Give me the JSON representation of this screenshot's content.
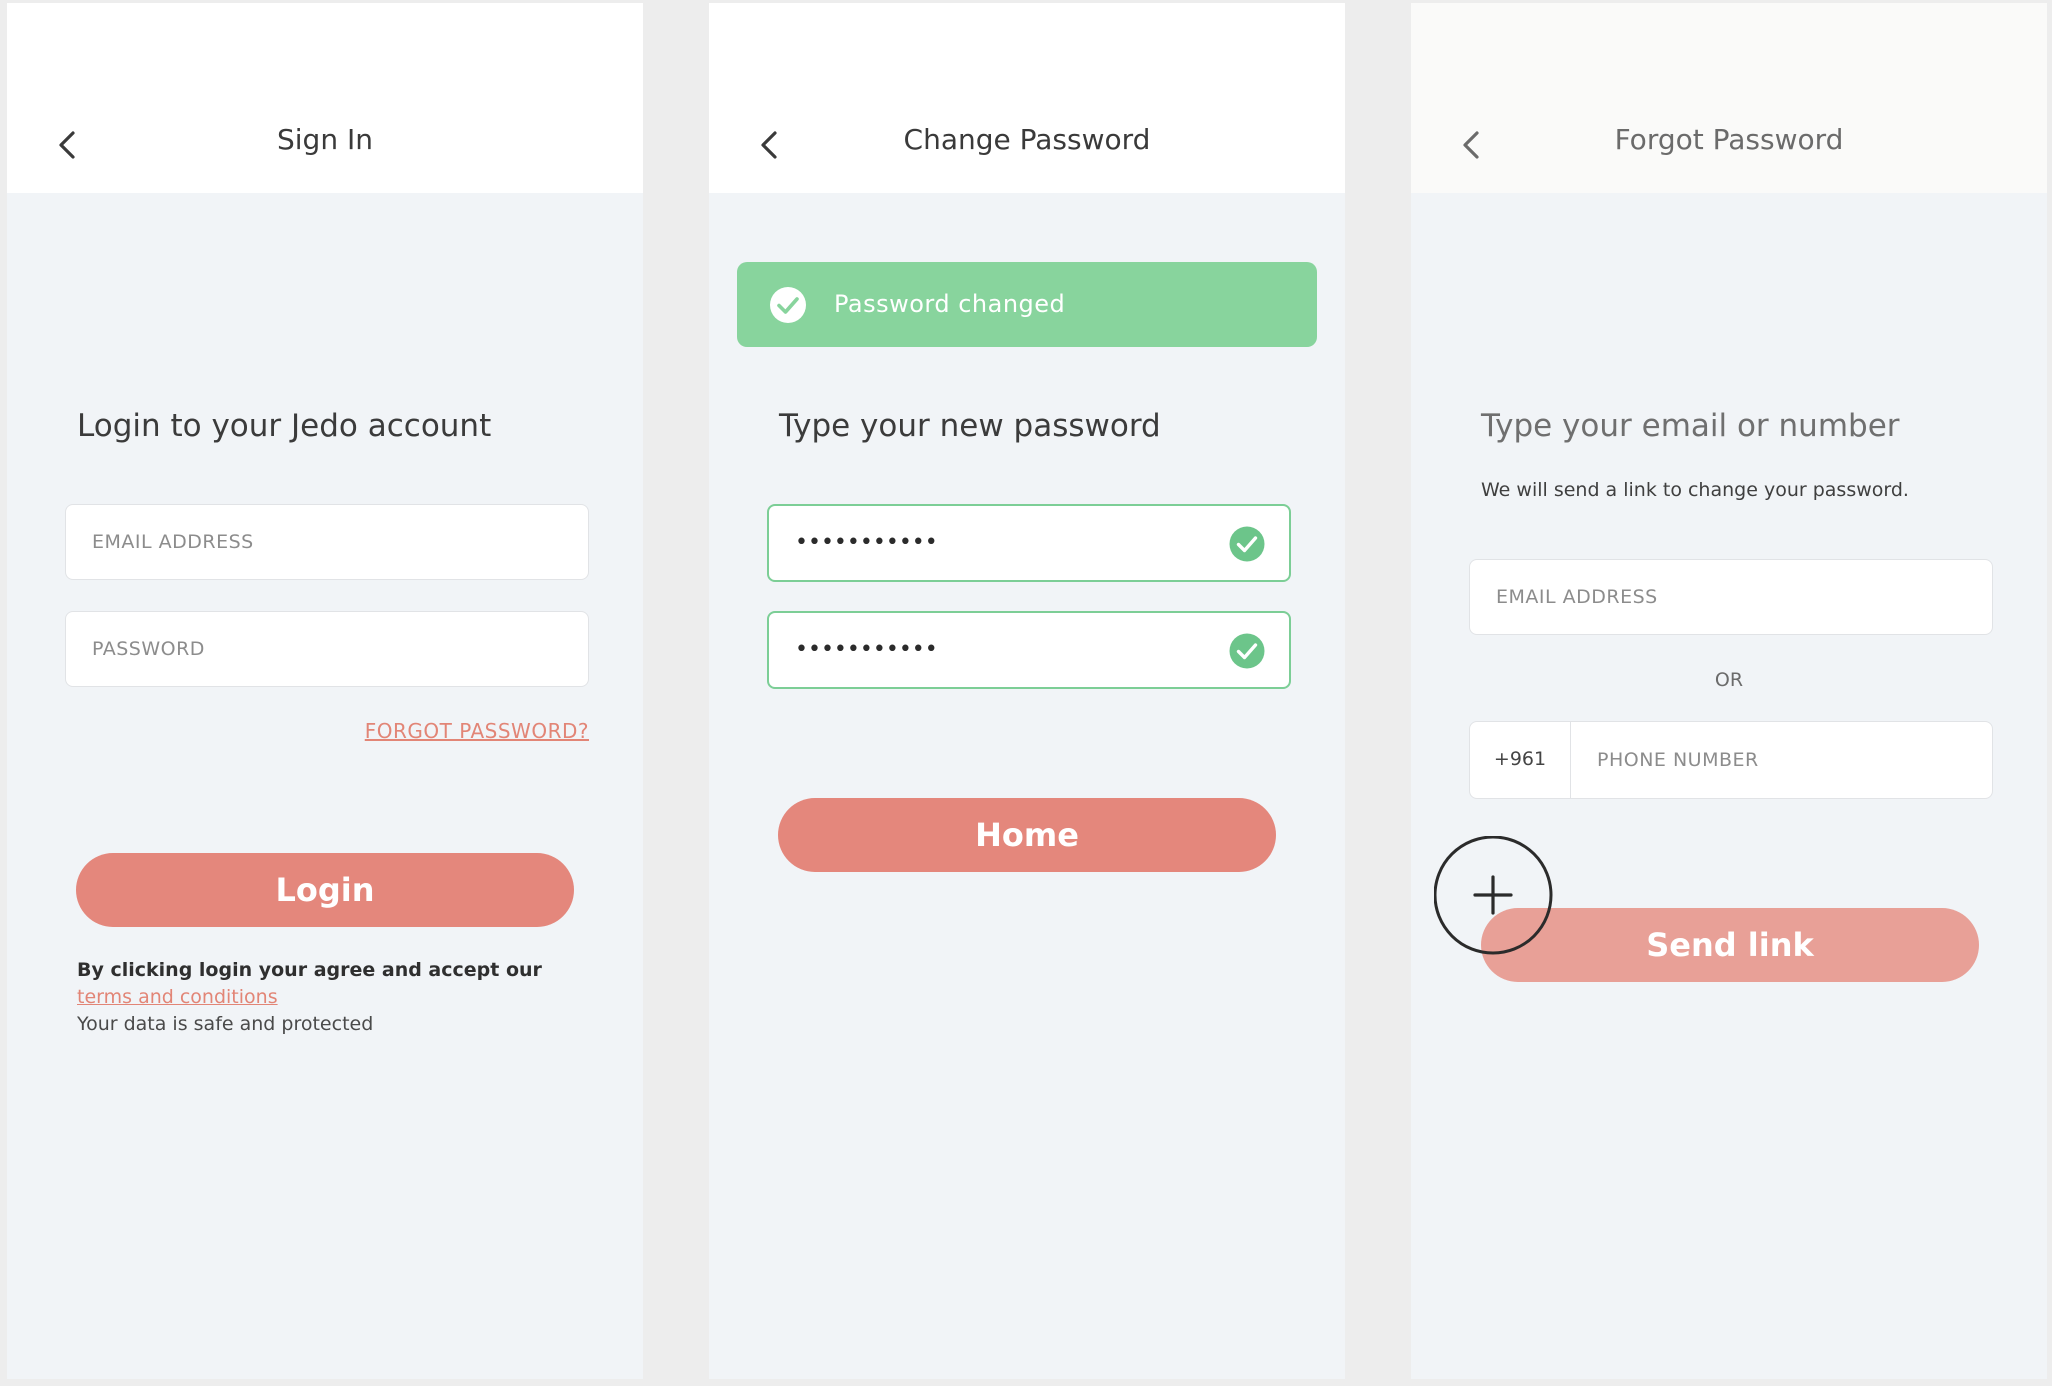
{
  "signin": {
    "title": "Sign In",
    "heading": "Login to your Jedo account",
    "email_placeholder": "EMAIL ADDRESS",
    "password_placeholder": "PASSWORD",
    "forgot_link": "FORGOT PASSWORD?",
    "login_button": "Login",
    "terms_prefix": "By clicking login your agree and accept our",
    "terms_link": "terms and conditions",
    "safety_note": "Your data is safe and protected"
  },
  "change": {
    "title": "Change Password",
    "toast": "Password changed",
    "heading": "Type your new password",
    "password_1": "•••••••••••",
    "password_2": "•••••••••••",
    "home_button": "Home"
  },
  "forgot": {
    "title": "Forgot Password",
    "heading": "Type your email or number",
    "subtext": "We will send a link to change your password.",
    "email_placeholder": "EMAIL ADDRESS",
    "or_label": "OR",
    "phone_prefix": "+961",
    "phone_placeholder": "PHONE NUMBER",
    "send_button": "Send link"
  },
  "icons": {
    "back": "chevron-left-icon",
    "success": "check-circle-icon",
    "cursor": "plus-cursor-icon"
  },
  "colors": {
    "accent": "#e4877c",
    "success": "#88d49d",
    "background": "#f1f4f7"
  }
}
